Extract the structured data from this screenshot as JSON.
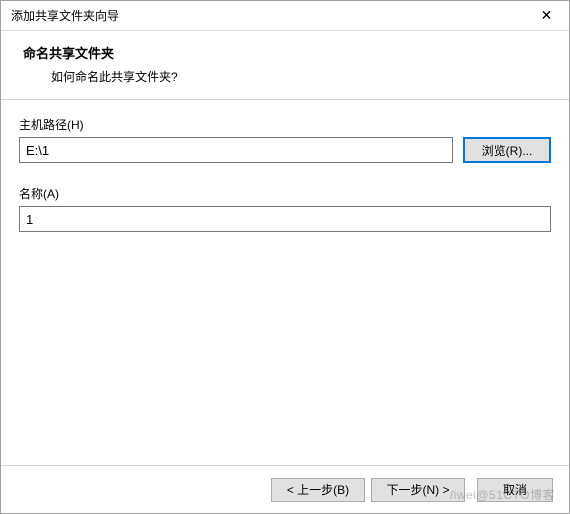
{
  "titlebar": {
    "title": "添加共享文件夹向导",
    "close_glyph": "✕"
  },
  "header": {
    "title": "命名共享文件夹",
    "subtitle": "如何命名此共享文件夹?"
  },
  "fields": {
    "host_path": {
      "label": "主机路径(H)",
      "value": "E:\\1",
      "browse_label": "浏览(R)..."
    },
    "name": {
      "label": "名称(A)",
      "value": "1"
    }
  },
  "footer": {
    "back": "< 上一步(B)",
    "next": "下一步(N) >",
    "cancel": "取消"
  },
  "watermark": "/iwei@51CTO博客"
}
